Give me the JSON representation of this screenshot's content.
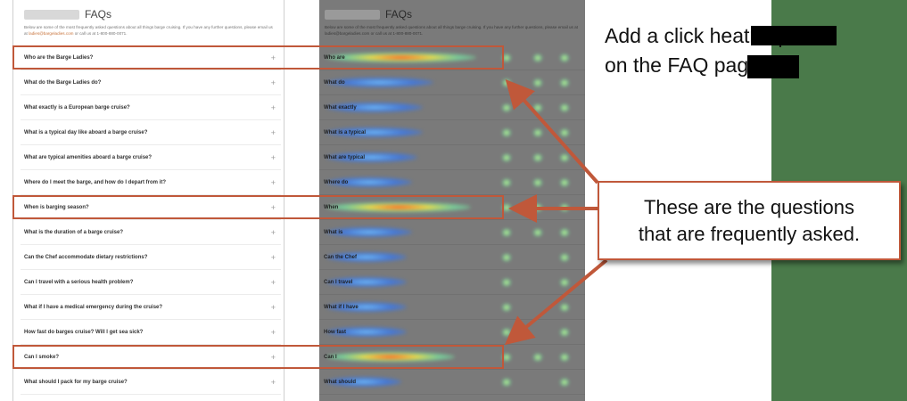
{
  "left_page": {
    "title": "FAQs",
    "intro_text": "Below are some of the most frequently asked questions about all things barge cruising. If you have any further questions, please email us at",
    "intro_email": "ladies@bargeladies.com",
    "intro_tail": " or call us at 1-800-880-0071.",
    "questions": [
      "Who are the Barge Ladies?",
      "What do the Barge Ladies do?",
      "What exactly is a European barge cruise?",
      "What is a typical day like aboard a barge cruise?",
      "What are typical amenities aboard a barge cruise?",
      "Where do I meet the barge, and how do I depart from it?",
      "When is barging season?",
      "What is the duration of a barge cruise?",
      "Can the Chef accommodate dietary restrictions?",
      "Can I travel with a serious health problem?",
      "What if I have a medical emergency during the cruise?",
      "How fast do barges cruise? Will I get sea sick?",
      "Can I smoke?",
      "What should I pack for my barge cruise?"
    ],
    "toggle_icon": "+"
  },
  "heatmap_page": {
    "title": "FAQs",
    "intro_text": "Below are some of the most frequently asked questions about all things barge cruising. If you have any further questions, please email us at ladies@bargeladies.com or call us at 1-800-880-0071.",
    "question_stubs": [
      "Who are",
      "What do",
      "What exactly",
      "What is a typical",
      "What are typical",
      "Where do",
      "When",
      "What is",
      "Can the Chef",
      "Can I travel",
      "What if I have",
      "How fast",
      "Can I",
      "What should"
    ],
    "row_scores": [
      0.9,
      0.5,
      0.4,
      0.4,
      0.35,
      0.3,
      0.85,
      0.3,
      0.25,
      0.25,
      0.25,
      0.25,
      0.7,
      0.2
    ]
  },
  "annotations": {
    "heatmap_note_line1": "Add a click heatmap",
    "heatmap_note_line2": "on the FAQ page",
    "callout_text": "These are the questions\nthat are frequently asked."
  },
  "colors": {
    "annotation_red": "#c0583a",
    "heatmap_background": "#7a7a7a",
    "green_strip": "#4a7a4a",
    "link_orange": "#c8733b"
  }
}
